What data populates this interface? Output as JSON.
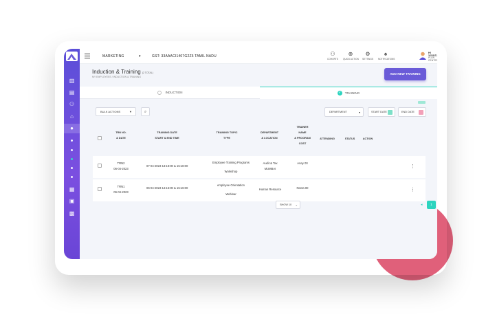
{
  "topbar": {
    "company": "MARKETING",
    "gst": "GST: 33AAACI1407G2Z5 TAMIL NADU",
    "icons": [
      {
        "icon": "cohorts-icon",
        "label": "COHORTS"
      },
      {
        "icon": "quick-action-icon",
        "label": "QUICK ACTION"
      },
      {
        "icon": "settings-icon",
        "label": "SETTINGS"
      },
      {
        "icon": "notifications-icon",
        "label": "NOTIFICATIONS"
      }
    ],
    "greeting": "HI YOGITA",
    "subtitle": "PLAN CENTER"
  },
  "page": {
    "title": "Induction & Training",
    "count": "(2 TOTAL)",
    "breadcrumb": "MY EMPLOYEES / INDUCTION & TRAINING",
    "add_button": "ADD NEW TRAINING"
  },
  "tabs": [
    {
      "label": "INDUCTION",
      "active": false
    },
    {
      "label": "TRAINING",
      "active": true
    }
  ],
  "filters": {
    "bulk_actions": "BULK ACTIONS",
    "department": "DEPARTMENT",
    "start_date": "START DATE",
    "end_date": "END DATE"
  },
  "table": {
    "headers": {
      "trn_no": [
        "TRN NO.",
        "& DATE"
      ],
      "training_date": [
        "TRAINING DATE",
        "START & END TIME"
      ],
      "topic": [
        "TRAINING TOPIC",
        "TYPE"
      ],
      "department": [
        "DEPARTMENT",
        "& LOCATION"
      ],
      "trainer": [
        "TRAINER",
        "NAME",
        "& PROGRAM",
        "COST"
      ],
      "attending": "ATTENDING",
      "status": "STATUS",
      "action": "ACTION"
    },
    "rows": [
      {
        "trn": "TRN2",
        "date": "06-04-2023",
        "time": "07-04-2023 13:18:00 & 15:18:00",
        "topic": "Employee Training Programs",
        "type": "Workshop",
        "department": "Audit & Tax",
        "location": "MUMBAI",
        "trainer": "Anay",
        "cost": "00"
      },
      {
        "trn": "TRN1",
        "date": "06-04-2023",
        "time": "06-04-2023 14:16:00 & 15:16:00",
        "topic": "employee Orientation",
        "type": "Webinar",
        "department": "Human Resource",
        "location": "",
        "trainer": "Neeta",
        "cost": "00"
      }
    ]
  },
  "pagination": {
    "show": "SHOW 10",
    "current": "1"
  },
  "colors": {
    "accent": "#6a5bd8",
    "teal": "#2dd4bf",
    "blob": "#e0607a"
  }
}
